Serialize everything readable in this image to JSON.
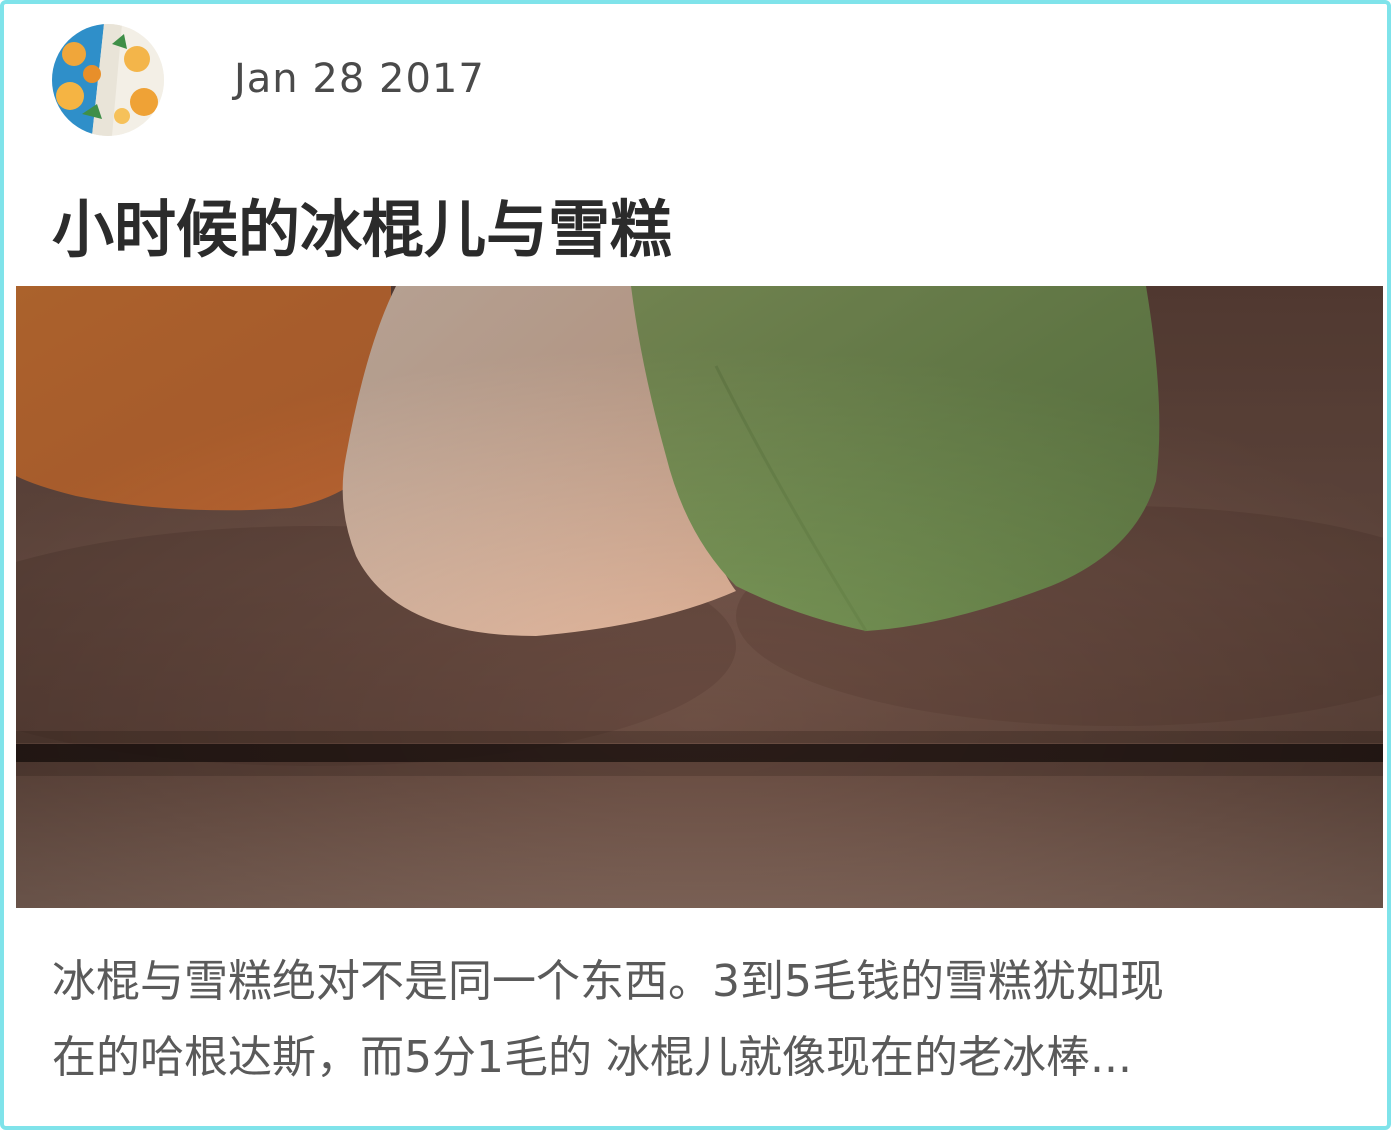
{
  "post": {
    "date": "Jan 28 2017",
    "title": "小时候的冰棍儿与雪糕",
    "excerpt": "冰棍与雪糕绝对不是同一个东西。3到5毛钱的雪糕犹如现\n在的哈根达斯，而5分1毛的 冰棍儿就像现在的老冰棒..."
  },
  "colors": {
    "card_border": "#7fe3ea",
    "title": "#2b2b2b",
    "date": "#4a4a4a",
    "excerpt": "#5a5a5a"
  }
}
